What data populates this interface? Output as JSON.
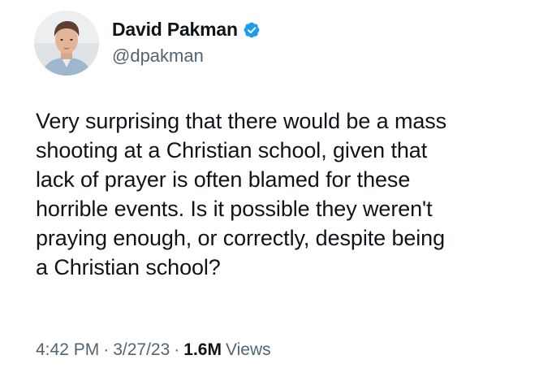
{
  "author": {
    "display_name": "David Pakman",
    "handle": "@dpakman",
    "verified": true
  },
  "tweet": {
    "text": "Very surprising that there would be a mass\nshooting at a Christian school, given that\nlack of prayer is often blamed for these\nhorrible events. Is it possible they weren't\npraying enough, or correctly, despite being\na Christian school?",
    "time": "4:42 PM",
    "separator": "·",
    "date": "3/27/23",
    "views_count": "1.6M",
    "views_label": "Views"
  },
  "colors": {
    "primary_text": "#0f1419",
    "secondary_text": "#536471",
    "verified_blue": "#1d9bf0"
  }
}
